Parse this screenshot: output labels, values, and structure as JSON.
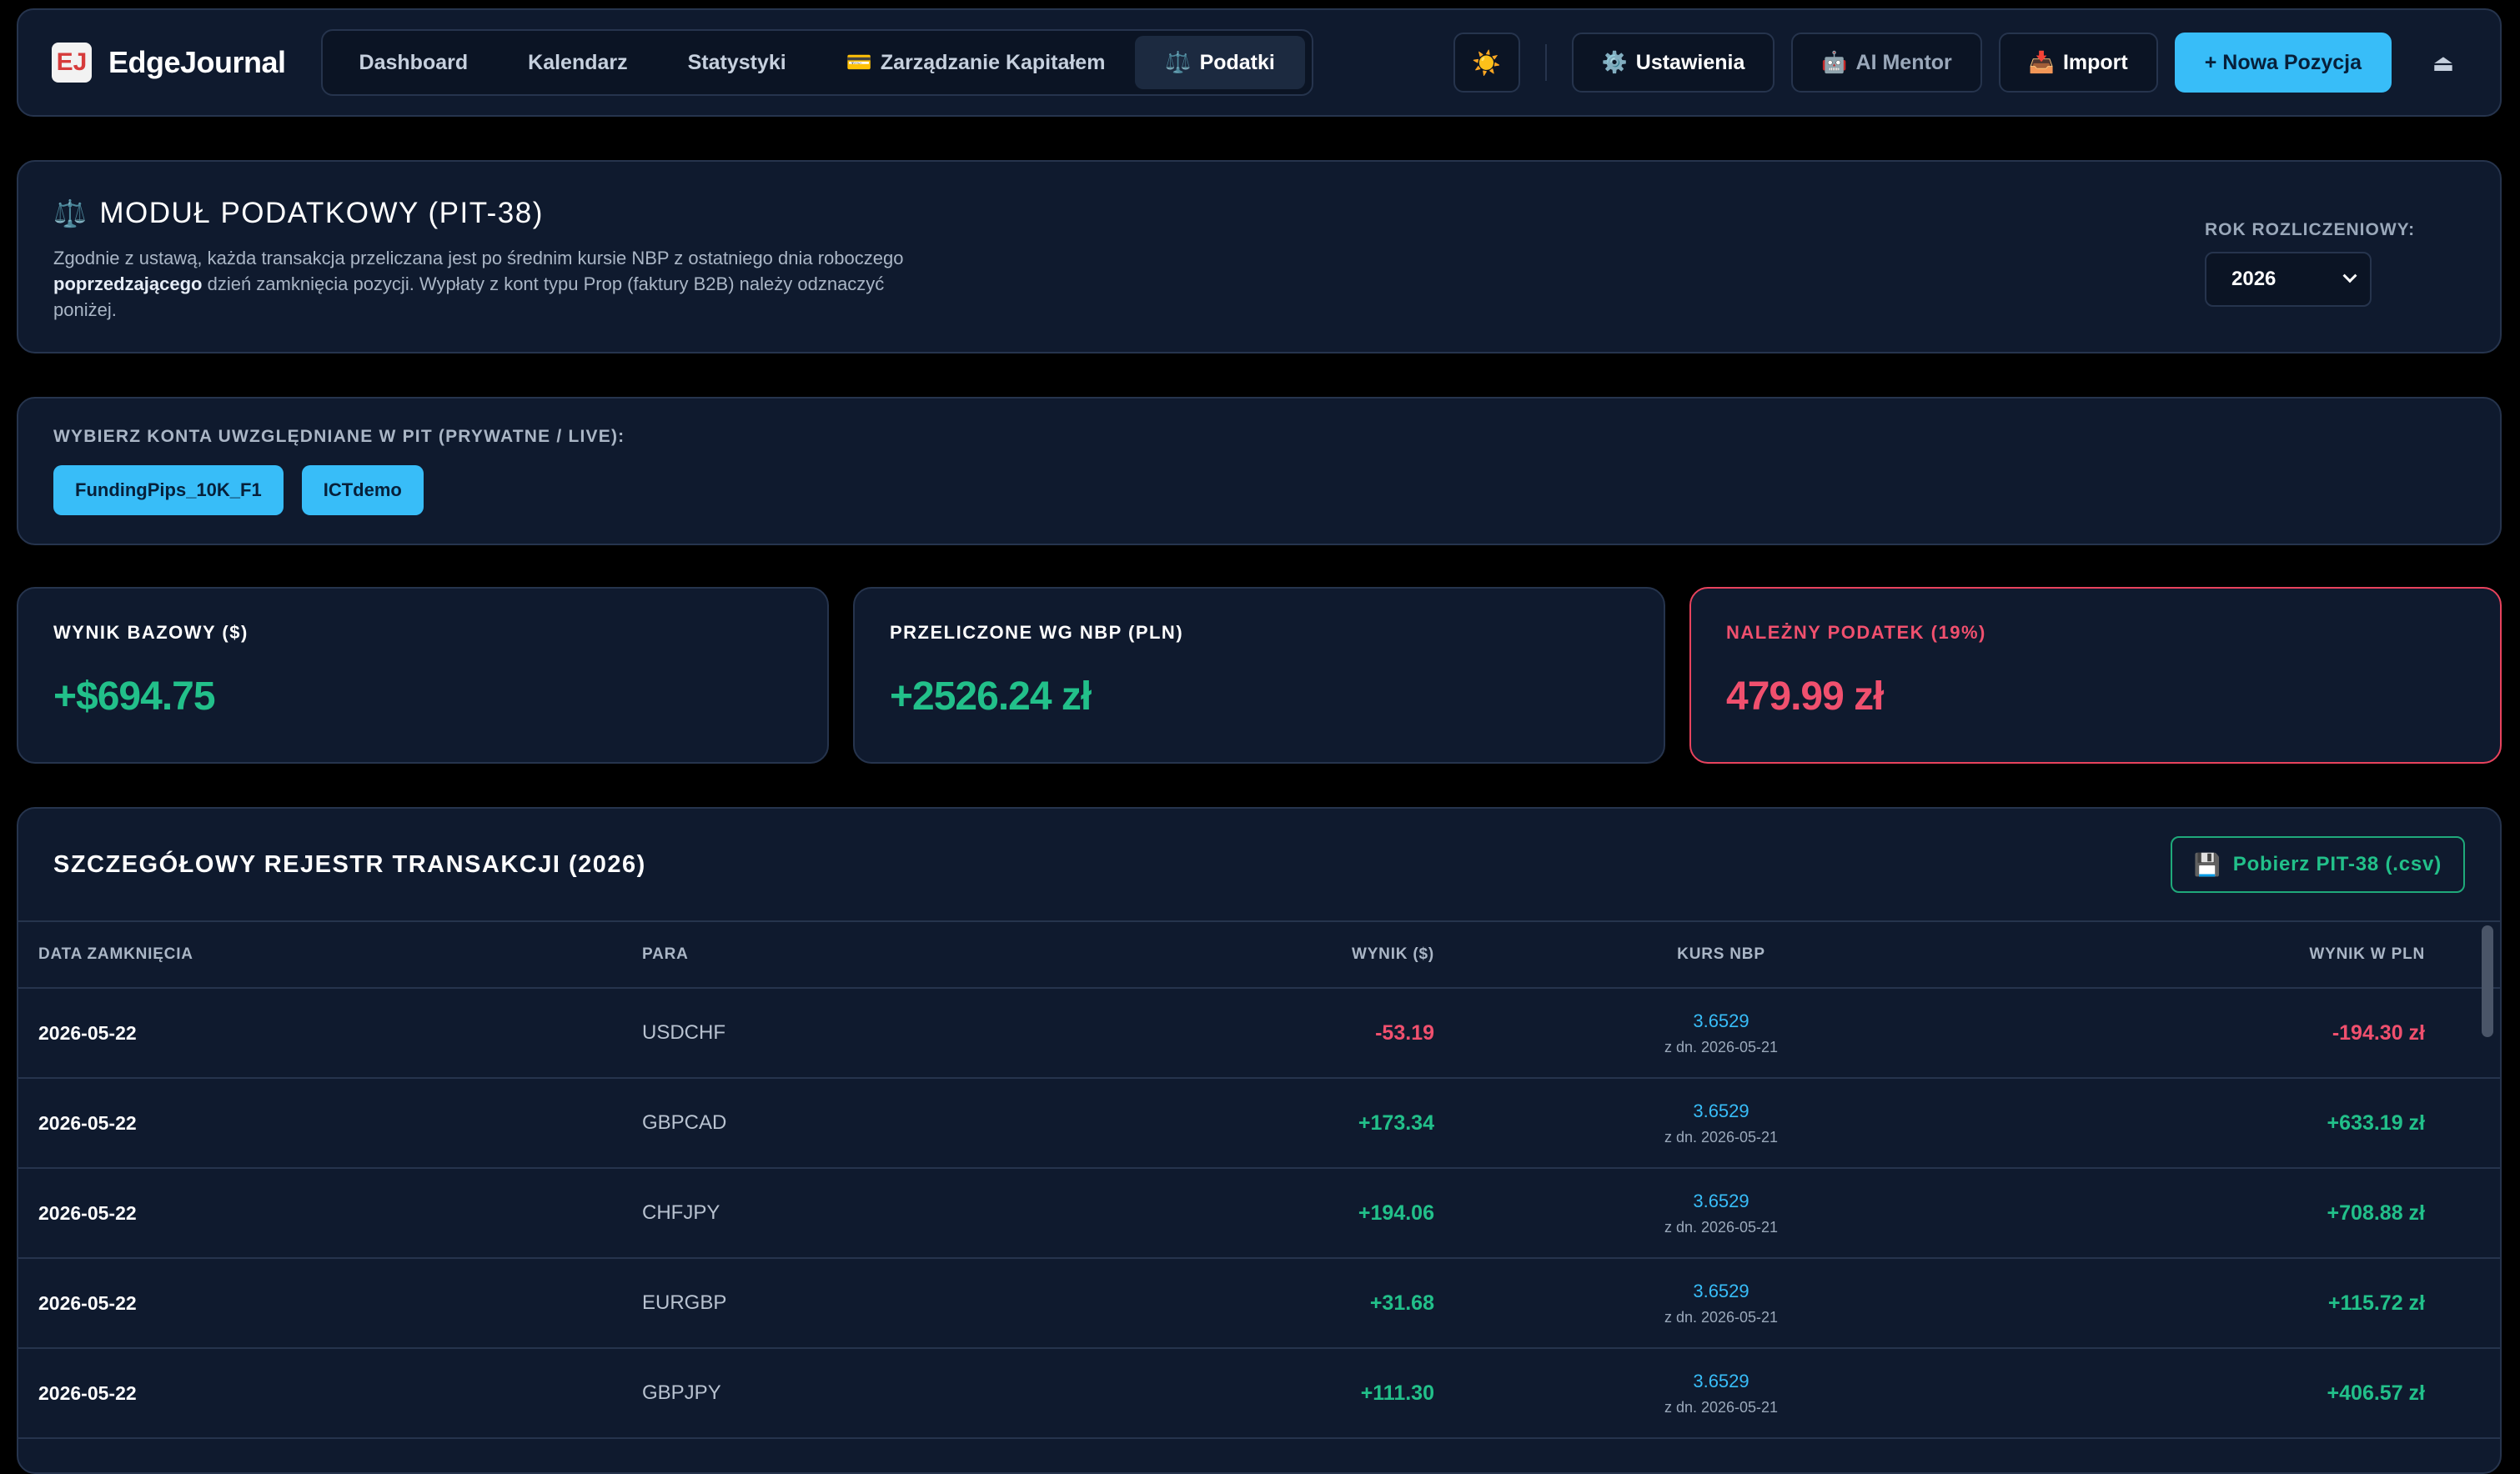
{
  "brand": {
    "name": "EdgeJournal",
    "logo_text": "EJ"
  },
  "nav": {
    "tabs": [
      {
        "label": "Dashboard",
        "icon": ""
      },
      {
        "label": "Kalendarz",
        "icon": ""
      },
      {
        "label": "Statystyki",
        "icon": ""
      },
      {
        "label": "Zarządzanie Kapitałem",
        "icon": "💳"
      },
      {
        "label": "Podatki",
        "icon": "⚖️"
      }
    ],
    "active_tab": "Podatki",
    "theme_icon": "☀️",
    "settings_label": "Ustawienia",
    "settings_icon": "⚙️",
    "ai_label": "AI Mentor",
    "ai_icon": "🤖",
    "import_label": "Import",
    "import_icon": "📥",
    "new_position_label": "+ Nowa Pozycja",
    "logout_icon": "⏏"
  },
  "tax_module": {
    "icon": "⚖️",
    "title": "MODUŁ PODATKOWY (PIT-38)",
    "desc_part1": "Zgodnie z ustawą, każda transakcja przeliczana jest po średnim kursie NBP z ostatniego dnia roboczego ",
    "desc_bold": "poprzedzającego",
    "desc_part2": " dzień zamknięcia pozycji. Wypłaty z kont typu Prop (faktury B2B) należy odznaczyć poniżej.",
    "year_label": "ROK ROZLICZENIOWY:",
    "year_value": "2026"
  },
  "accounts": {
    "label": "WYBIERZ KONTA UWZGLĘDNIANE W PIT (PRYWATNE / LIVE):",
    "items": [
      "FundingPips_10K_F1",
      "ICTdemo"
    ]
  },
  "stats": [
    {
      "label": "WYNIK BAZOWY ($)",
      "value": "+$694.75",
      "tone": "green"
    },
    {
      "label": "PRZELICZONE WG NBP (PLN)",
      "value": "+2526.24 zł",
      "tone": "green"
    },
    {
      "label": "NALEŻNY PODATEK (19%)",
      "value": "479.99 zł",
      "tone": "red"
    }
  ],
  "register": {
    "title": "SZCZEGÓŁOWY REJESTR TRANSAKCJI (2026)",
    "download_icon": "💾",
    "download_label": "Pobierz PIT-38 (.csv)",
    "columns": [
      "DATA ZAMKNIĘCIA",
      "PARA",
      "WYNIK ($)",
      "KURS NBP",
      "WYNIK W PLN"
    ],
    "rows": [
      {
        "date": "2026-05-22",
        "pair": "USDCHF",
        "result_usd": "-53.19",
        "rate": "3.6529",
        "rate_date": "z dn. 2026-05-21",
        "result_pln": "-194.30 zł",
        "tone": "red"
      },
      {
        "date": "2026-05-22",
        "pair": "GBPCAD",
        "result_usd": "+173.34",
        "rate": "3.6529",
        "rate_date": "z dn. 2026-05-21",
        "result_pln": "+633.19 zł",
        "tone": "green"
      },
      {
        "date": "2026-05-22",
        "pair": "CHFJPY",
        "result_usd": "+194.06",
        "rate": "3.6529",
        "rate_date": "z dn. 2026-05-21",
        "result_pln": "+708.88 zł",
        "tone": "green"
      },
      {
        "date": "2026-05-22",
        "pair": "EURGBP",
        "result_usd": "+31.68",
        "rate": "3.6529",
        "rate_date": "z dn. 2026-05-21",
        "result_pln": "+115.72 zł",
        "tone": "green"
      },
      {
        "date": "2026-05-22",
        "pair": "GBPJPY",
        "result_usd": "+111.30",
        "rate": "3.6529",
        "rate_date": "z dn. 2026-05-21",
        "result_pln": "+406.57 zł",
        "tone": "green"
      }
    ]
  },
  "colors": {
    "accent": "#38bdf8",
    "positive": "#22c08a",
    "negative": "#f0506e",
    "panel": "#0f1a2e",
    "border": "#26344d"
  }
}
